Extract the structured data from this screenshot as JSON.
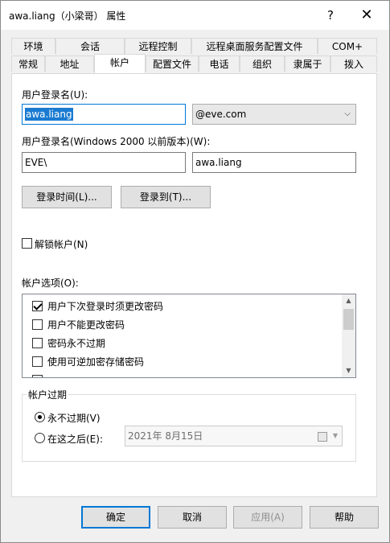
{
  "window": {
    "title": "awa.liang（小梁哥） 属性",
    "help_icon": "?",
    "close_icon": "✕"
  },
  "tabs_row1": [
    "环境",
    "会话",
    "远程控制",
    "远程桌面服务配置文件",
    "COM+"
  ],
  "tabs_row2": [
    "常规",
    "地址",
    "帐户",
    "配置文件",
    "电话",
    "组织",
    "隶属于",
    "拨入"
  ],
  "active_tab": "帐户",
  "account": {
    "logon_name_label": "用户登录名(U):",
    "logon_name_value": "awa.liang",
    "domain_value": "@eve.com",
    "prewin2000_label": "用户登录名(Windows 2000 以前版本)(W):",
    "prewin2000_domain": "EVE\\",
    "prewin2000_name": "awa.liang",
    "logon_hours_button": "登录时间(L)...",
    "logon_to_button": "登录到(T)...",
    "unlock_label": "解锁帐户(N)",
    "unlock_checked": false,
    "options_label": "帐户选项(O):",
    "options": [
      {
        "label": "用户下次登录时须更改密码",
        "checked": true
      },
      {
        "label": "用户不能更改密码",
        "checked": false
      },
      {
        "label": "密码永不过期",
        "checked": false
      },
      {
        "label": "使用可逆加密存储密码",
        "checked": false
      }
    ],
    "expires_group_label": "帐户过期",
    "never_expires_label": "永不过期(V)",
    "end_of_label": "在这之后(E):",
    "end_of_date": "2021年  8月15日",
    "selected_expiry": "never"
  },
  "footer": {
    "ok": "确定",
    "cancel": "取消",
    "apply": "应用(A)",
    "help": "帮助"
  },
  "colors": {
    "selection": "#1a7bd1",
    "default_button_border": "#0078d7",
    "dialog_bg": "#f0f0f0"
  }
}
